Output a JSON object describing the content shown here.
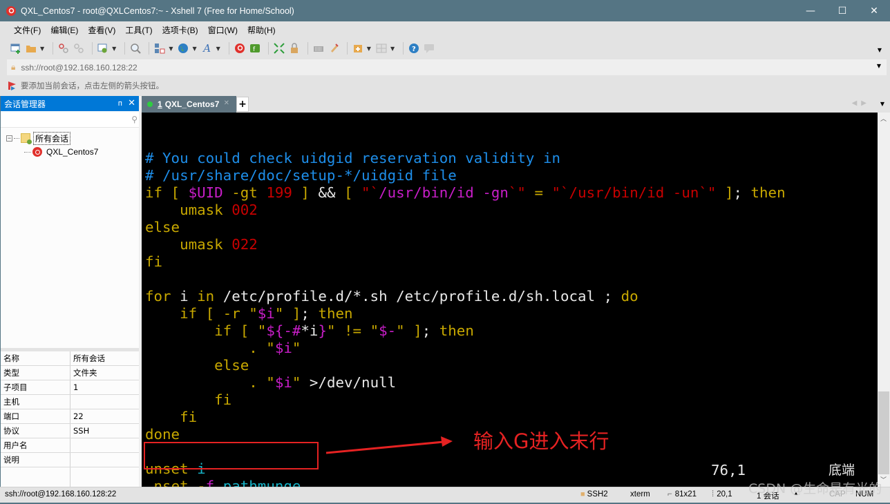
{
  "window": {
    "title": "QXL_Centos7 - root@QXLCentos7:~ - Xshell 7 (Free for Home/School)",
    "minimize": "—",
    "maximize": "☐",
    "close": "✕"
  },
  "menu": [
    "文件(F)",
    "编辑(E)",
    "查看(V)",
    "工具(T)",
    "选项卡(B)",
    "窗口(W)",
    "帮助(H)"
  ],
  "toolbar": {
    "icons": [
      "new-session-icon",
      "open-folder-icon",
      "reconnect-icon",
      "disconnect-icon",
      "properties-icon",
      "find-icon",
      "transfer-icon",
      "globe-icon",
      "font-icon",
      "xshell-icon",
      "xftp-icon",
      "fullscreen-icon",
      "lock-icon",
      "keyboard-icon",
      "highlight-icon",
      "new-tab-icon",
      "layout-icon",
      "help-icon",
      "chat-icon"
    ]
  },
  "address": {
    "value": "ssh://root@192.168.160.128:22"
  },
  "hint": {
    "text": "要添加当前会话，点击左侧的箭头按钮。"
  },
  "session_manager": {
    "title": "会话管理器",
    "pin": "ᴨ",
    "close": "✕",
    "search_placeholder": "",
    "tree": {
      "folder": "所有会话",
      "sessions": [
        "QXL_Centos7"
      ]
    },
    "properties": [
      {
        "key": "名称",
        "value": "所有会话"
      },
      {
        "key": "类型",
        "value": "文件夹"
      },
      {
        "key": "子项目",
        "value": "1"
      },
      {
        "key": "主机",
        "value": ""
      },
      {
        "key": "端口",
        "value": "22"
      },
      {
        "key": "协议",
        "value": "SSH"
      },
      {
        "key": "用户名",
        "value": ""
      },
      {
        "key": "说明",
        "value": ""
      }
    ]
  },
  "tabs": [
    {
      "index": "1",
      "label": "QXL_Centos7",
      "active": true,
      "status_color": "#2ecc40"
    }
  ],
  "tab_add": "+",
  "terminal": {
    "lines": [
      [
        {
          "t": "# You could check uidgid reservation validity in",
          "c": "cmt"
        }
      ],
      [
        {
          "t": "# /usr/share/doc/setup-*/uidgid file",
          "c": "cmt"
        }
      ],
      [
        {
          "t": "if [ ",
          "c": "kw"
        },
        {
          "t": "$UID",
          "c": "var"
        },
        {
          "t": " -gt ",
          "c": "kw"
        },
        {
          "t": "199",
          "c": "num"
        },
        {
          "t": " ] ",
          "c": "kw"
        },
        {
          "t": "&&",
          "c": "wht"
        },
        {
          "t": " [ ",
          "c": "kw"
        },
        {
          "t": "\"`",
          "c": "str"
        },
        {
          "t": "/usr/bin/id -gn",
          "c": "var"
        },
        {
          "t": "`\"",
          "c": "str"
        },
        {
          "t": " = ",
          "c": "kw"
        },
        {
          "t": "\"`/usr/bin/id -un`\"",
          "c": "str"
        },
        {
          "t": " ]",
          "c": "kw"
        },
        {
          "t": "; ",
          "c": "wht"
        },
        {
          "t": "then",
          "c": "kw"
        }
      ],
      [
        {
          "t": "    umask ",
          "c": "kw"
        },
        {
          "t": "002",
          "c": "num"
        }
      ],
      [
        {
          "t": "else",
          "c": "kw"
        }
      ],
      [
        {
          "t": "    umask ",
          "c": "kw"
        },
        {
          "t": "022",
          "c": "num"
        }
      ],
      [
        {
          "t": "fi",
          "c": "kw"
        }
      ],
      [
        {
          "t": "",
          "c": "wht"
        }
      ],
      [
        {
          "t": "for",
          "c": "kw"
        },
        {
          "t": " i ",
          "c": "wht"
        },
        {
          "t": "in",
          "c": "kw"
        },
        {
          "t": " /etc/profile.d/*.sh /etc/profile.d/sh.local ; ",
          "c": "wht"
        },
        {
          "t": "do",
          "c": "kw"
        }
      ],
      [
        {
          "t": "    if [ -r ",
          "c": "kw"
        },
        {
          "t": "\"",
          "c": "kw"
        },
        {
          "t": "$i",
          "c": "var"
        },
        {
          "t": "\" ]",
          "c": "kw"
        },
        {
          "t": "; ",
          "c": "wht"
        },
        {
          "t": "then",
          "c": "kw"
        }
      ],
      [
        {
          "t": "        if [ ",
          "c": "kw"
        },
        {
          "t": "\"",
          "c": "kw"
        },
        {
          "t": "${-#",
          "c": "var"
        },
        {
          "t": "*i",
          "c": "wht"
        },
        {
          "t": "}",
          "c": "var"
        },
        {
          "t": "\" != \"",
          "c": "kw"
        },
        {
          "t": "$-",
          "c": "var"
        },
        {
          "t": "\" ]",
          "c": "kw"
        },
        {
          "t": "; ",
          "c": "wht"
        },
        {
          "t": "then",
          "c": "kw"
        }
      ],
      [
        {
          "t": "            . ",
          "c": "kw"
        },
        {
          "t": "\"",
          "c": "kw"
        },
        {
          "t": "$i",
          "c": "var"
        },
        {
          "t": "\"",
          "c": "kw"
        }
      ],
      [
        {
          "t": "        else",
          "c": "kw"
        }
      ],
      [
        {
          "t": "            . ",
          "c": "kw"
        },
        {
          "t": "\"",
          "c": "kw"
        },
        {
          "t": "$i",
          "c": "var"
        },
        {
          "t": "\"",
          "c": "kw"
        },
        {
          "t": " >/dev/null",
          "c": "wht"
        }
      ],
      [
        {
          "t": "        fi",
          "c": "kw"
        }
      ],
      [
        {
          "t": "    fi",
          "c": "kw"
        }
      ],
      [
        {
          "t": "done",
          "c": "kw"
        }
      ],
      [
        {
          "t": "",
          "c": "wht"
        }
      ],
      [
        {
          "t": "unset",
          "c": "kw"
        },
        {
          "t": " i",
          "c": "cyn"
        }
      ],
      [
        {
          "t": "u",
          "c": "cursor"
        },
        {
          "t": "nset",
          "c": "kw"
        },
        {
          "t": " -",
          "c": "kw"
        },
        {
          "t": "f",
          "c": "var"
        },
        {
          "t": " pathmunge",
          "c": "cyn"
        }
      ]
    ],
    "cursor_position": "76,1",
    "scroll_position_label": "底端",
    "scroll_position": 1.0
  },
  "annotation": {
    "text": "输入G进入末行",
    "color": "#e52222"
  },
  "statusbar": {
    "address": "ssh://root@192.168.160.128:22",
    "protocol": "SSH2",
    "terminal_type": "xterm",
    "size": "81x21",
    "cursor": "20,1",
    "sessions": "1 会话",
    "caps": "CAP",
    "num": "NUM"
  },
  "watermark": "CSDN @生命是有光的"
}
